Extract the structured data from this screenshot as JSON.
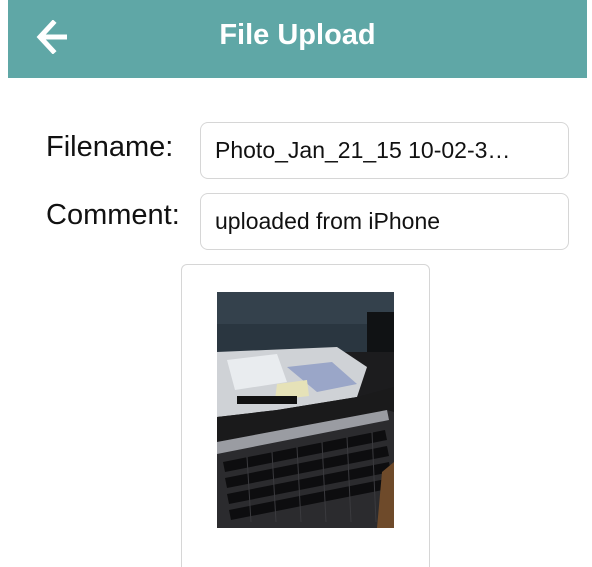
{
  "header": {
    "title": "File Upload",
    "back_icon": "arrow-left-icon",
    "background_color": "#5fa7a6"
  },
  "form": {
    "filename_label": "Filename:",
    "filename_value": "Photo_Jan_21_15 10-02-3…",
    "comment_label": "Comment:",
    "comment_value": "uploaded from iPhone"
  },
  "preview": {
    "image_subject": "photo-of-desk-with-keyboard"
  }
}
